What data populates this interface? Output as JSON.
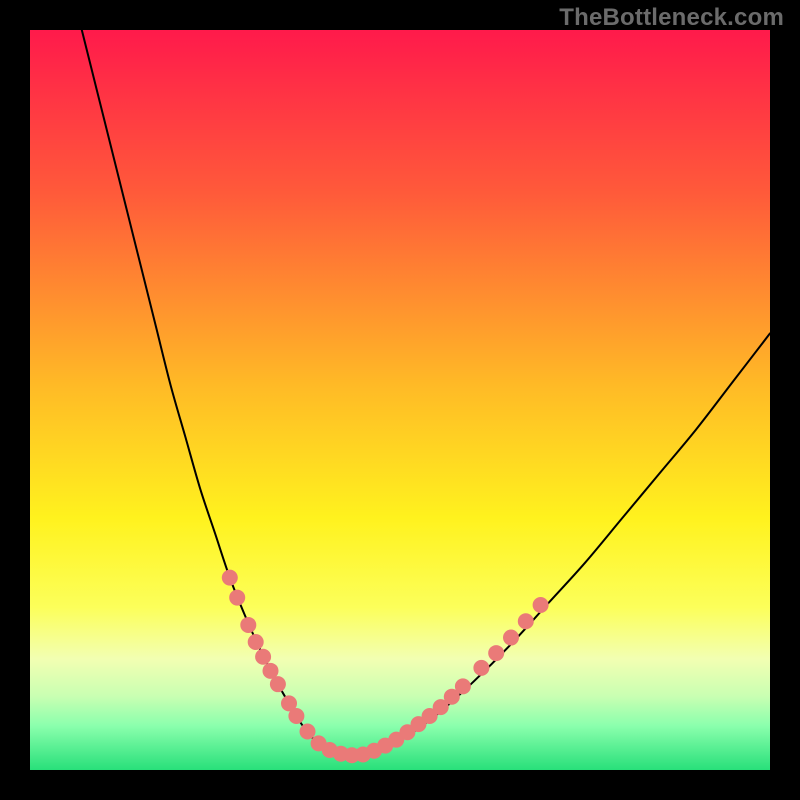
{
  "watermark": "TheBottleneck.com",
  "chart_data": {
    "type": "line",
    "title": "",
    "xlabel": "",
    "ylabel": "",
    "xlim": [
      0,
      100
    ],
    "ylim": [
      0,
      100
    ],
    "background_gradient": {
      "stops": [
        {
          "offset": 0,
          "color": "#ff1a4b"
        },
        {
          "offset": 22,
          "color": "#ff5a3a"
        },
        {
          "offset": 48,
          "color": "#ffba26"
        },
        {
          "offset": 66,
          "color": "#fff21e"
        },
        {
          "offset": 78,
          "color": "#fcff5a"
        },
        {
          "offset": 85,
          "color": "#f2ffb2"
        },
        {
          "offset": 90,
          "color": "#c9ffb2"
        },
        {
          "offset": 94,
          "color": "#8bffad"
        },
        {
          "offset": 100,
          "color": "#28e07a"
        }
      ]
    },
    "series": [
      {
        "name": "bottleneck-curve",
        "color": "#000000",
        "stroke_width": 2,
        "x": [
          7,
          9,
          11,
          13,
          15,
          17,
          19,
          21,
          23,
          25,
          27,
          29,
          31,
          33,
          35,
          36.5,
          38,
          40,
          42,
          44,
          46,
          50,
          55,
          60,
          65,
          70,
          75,
          80,
          85,
          90,
          95,
          100
        ],
        "y": [
          100,
          92,
          84,
          76,
          68,
          60,
          52,
          45,
          38,
          32,
          26,
          21,
          16.5,
          12.5,
          9,
          6.5,
          4.5,
          3,
          2.2,
          2,
          2.4,
          4,
          7.5,
          12,
          17,
          22.5,
          28,
          34,
          40,
          46,
          52.5,
          59
        ]
      }
    ],
    "markers": {
      "name": "bottleneck-band-markers",
      "color": "#ea7a78",
      "radius": 8,
      "points": [
        {
          "x": 27.0,
          "y": 26.0
        },
        {
          "x": 28.0,
          "y": 23.3
        },
        {
          "x": 29.5,
          "y": 19.6
        },
        {
          "x": 30.5,
          "y": 17.3
        },
        {
          "x": 31.5,
          "y": 15.3
        },
        {
          "x": 32.5,
          "y": 13.4
        },
        {
          "x": 33.5,
          "y": 11.6
        },
        {
          "x": 35.0,
          "y": 9.0
        },
        {
          "x": 36.0,
          "y": 7.3
        },
        {
          "x": 37.5,
          "y": 5.2
        },
        {
          "x": 39.0,
          "y": 3.6
        },
        {
          "x": 40.5,
          "y": 2.7
        },
        {
          "x": 42.0,
          "y": 2.2
        },
        {
          "x": 43.5,
          "y": 2.0
        },
        {
          "x": 45.0,
          "y": 2.1
        },
        {
          "x": 46.5,
          "y": 2.6
        },
        {
          "x": 48.0,
          "y": 3.3
        },
        {
          "x": 49.5,
          "y": 4.1
        },
        {
          "x": 51.0,
          "y": 5.1
        },
        {
          "x": 52.5,
          "y": 6.2
        },
        {
          "x": 54.0,
          "y": 7.3
        },
        {
          "x": 55.5,
          "y": 8.5
        },
        {
          "x": 57.0,
          "y": 9.9
        },
        {
          "x": 58.5,
          "y": 11.3
        },
        {
          "x": 61.0,
          "y": 13.8
        },
        {
          "x": 63.0,
          "y": 15.8
        },
        {
          "x": 65.0,
          "y": 17.9
        },
        {
          "x": 67.0,
          "y": 20.1
        },
        {
          "x": 69.0,
          "y": 22.3
        }
      ]
    }
  }
}
